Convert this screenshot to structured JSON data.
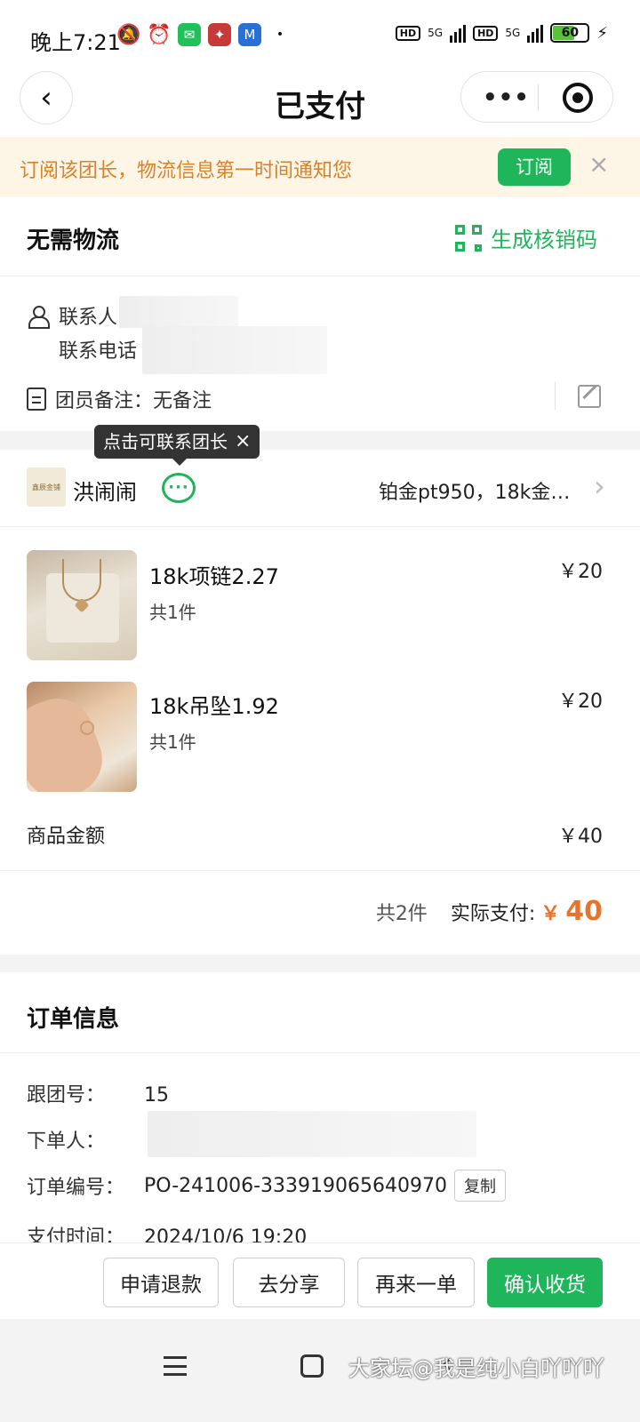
{
  "status_bar": {
    "time": "晚上7:21",
    "battery": "60",
    "network": [
      "5G",
      "5G"
    ],
    "hd": "HD"
  },
  "nav": {
    "title": "已支付",
    "more": "•••"
  },
  "notice": {
    "text": "订阅该团长，物流信息第一时间通知您",
    "subscribe_label": "订阅",
    "close": "×"
  },
  "delivery": {
    "title": "无需物流",
    "qr_label": "生成核销码"
  },
  "contact": {
    "name_label": "联系人",
    "phone_label": "联系电话",
    "remark_label": "团员备注：",
    "remark_value": "无备注"
  },
  "tooltip": {
    "text": "点击可联系团长",
    "close": "×"
  },
  "shop": {
    "logo_text": "鑫辰金铺",
    "name": "洪闹闹",
    "description": "铂金pt950，18k金…",
    "chevron": "›"
  },
  "items": [
    {
      "name": "18k项链2.27",
      "qty": "共1件",
      "price": "￥20"
    },
    {
      "name": "18k吊坠1.92",
      "qty": "共1件",
      "price": "￥20"
    }
  ],
  "summary": {
    "goods_amount_label": "商品金额",
    "goods_amount": "￥40",
    "total_count": "共2件",
    "actual_label": "实际支付:",
    "currency": "￥",
    "actual_amount": "40"
  },
  "order_info": {
    "title": "订单信息",
    "group_no_label": "跟团号：",
    "group_no": "15",
    "orderer_label": "下单人：",
    "order_no_label": "订单编号：",
    "order_no": "PO-241006-333919065640970",
    "copy_label": "复制",
    "pay_time_label": "支付时间：",
    "pay_time": "2024/10/6 19:20"
  },
  "actions": {
    "refund": "申请退款",
    "share": "去分享",
    "reorder": "再来一单",
    "confirm": "确认收货"
  },
  "watermark": "大家坛@我是纯小白吖吖吖",
  "colors": {
    "accent_green": "#1fb55b",
    "price_orange": "#e8742a",
    "notice_bg": "#fdf5e5",
    "notice_text": "#d9822b"
  },
  "icons": {
    "back": "chevron-left-icon",
    "capsule_more": "more-dots-icon",
    "capsule_close": "target-icon",
    "qr": "qr-code-icon",
    "person": "person-icon",
    "doc": "document-icon",
    "edit": "edit-icon",
    "chat": "chat-bubble-icon"
  }
}
